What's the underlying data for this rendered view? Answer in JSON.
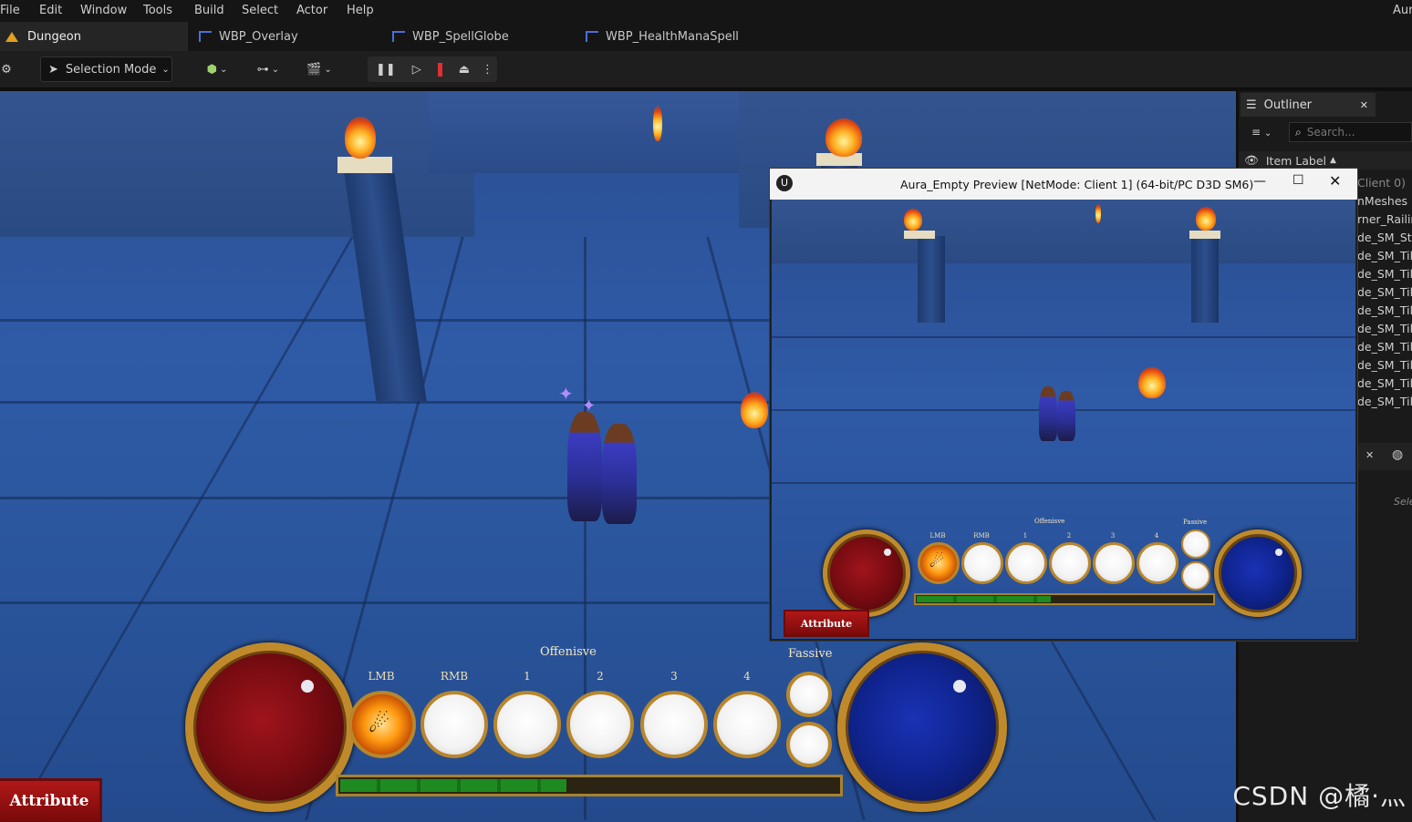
{
  "menu": {
    "items": [
      "File",
      "Edit",
      "Window",
      "Tools",
      "Build",
      "Select",
      "Actor",
      "Help"
    ],
    "right_text": "Aur"
  },
  "tabs": [
    {
      "label": "Dungeon",
      "active": true
    },
    {
      "label": "WBP_Overlay",
      "active": false
    },
    {
      "label": "WBP_SpellGlobe",
      "active": false
    },
    {
      "label": "WBP_HealthManaSpell",
      "active": false
    }
  ],
  "toolbar": {
    "selection_mode": "Selection Mode"
  },
  "hud": {
    "offensive_label": "Offenisve",
    "passive_label": "Fassive",
    "slot_labels": [
      "LMB",
      "RMB",
      "1",
      "2",
      "3",
      "4"
    ],
    "attribute_label": "Attribute",
    "xp_progress": 0.45
  },
  "preview": {
    "title": "Aura_Empty Preview [NetMode: Client 1]  (64-bit/PC D3D SM6)",
    "offensive_label": "Offenisve",
    "passive_label": "Passive",
    "slot_labels": [
      "LMB",
      "RMB",
      "1",
      "2",
      "3",
      "4"
    ],
    "attribute_label": "Attribute",
    "xp_progress": 0.45
  },
  "outliner": {
    "title": "Outliner",
    "search_placeholder": "Search...",
    "column_label": "Item Label",
    "rows": [
      "Client 0)",
      "nMeshes",
      "rner_Railin",
      "de_SM_Sta",
      "de_SM_Til",
      "de_SM_Til",
      "de_SM_Til",
      "de_SM_Til",
      "de_SM_Til",
      "de_SM_Til",
      "de_SM_Til",
      "de_SM_Til",
      "de_SM_Til"
    ],
    "details_text": "Sele"
  },
  "watermark": "CSDN @橘·灬",
  "colors": {
    "accent": "#4a6fd8",
    "gold": "#c08a2a",
    "health": "#a0141c",
    "mana": "#1a32b5",
    "xp": "#1f8a1f",
    "stop": "#e03030"
  }
}
